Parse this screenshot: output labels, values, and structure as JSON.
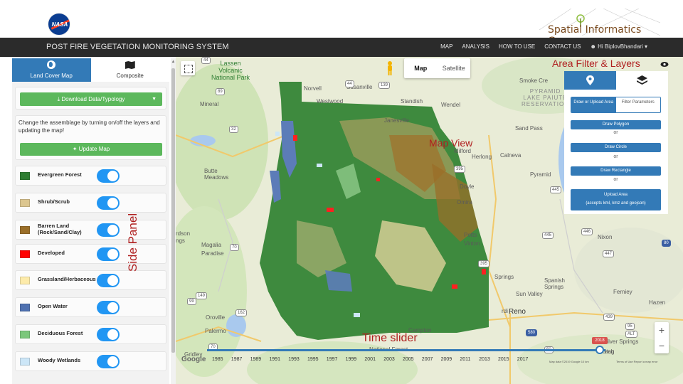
{
  "header": {
    "nasa_logo_text": "NASA",
    "sig_logo_text": "Spatial Informatics Group"
  },
  "navbar": {
    "title": "POST FIRE VEGETATION MONITORING SYSTEM",
    "links": [
      "MAP",
      "ANALYSIS",
      "HOW TO USE",
      "CONTACT US"
    ],
    "user": "Hi BiplovBhandari"
  },
  "side_panel": {
    "tabs": [
      {
        "label": "Land Cover Map",
        "icon": "globe-icon"
      },
      {
        "label": "Composite",
        "icon": "map-icon"
      }
    ],
    "download_label": "Download Data/Typology",
    "assemblage_text": "Change the assemblage by turning on/off the layers and updating the map!",
    "update_label": "Update Map",
    "legend": [
      {
        "label": "Evergreen Forest",
        "color": "#2e7d32",
        "on": true
      },
      {
        "label": "Shrub/Scrub",
        "color": "#dcc68f",
        "on": true
      },
      {
        "label": "Barren Land (Rock/Sand/Clay)",
        "color": "#9a6e28",
        "on": true
      },
      {
        "label": "Developed",
        "color": "#ff0000",
        "on": true
      },
      {
        "label": "Grassland/Herbaceous",
        "color": "#fdebaa",
        "on": true
      },
      {
        "label": "Open Water",
        "color": "#4f71b0",
        "on": true
      },
      {
        "label": "Deciduous Forest",
        "color": "#7bc77b",
        "on": true
      },
      {
        "label": "Woody Wetlands",
        "color": "#cce6f7",
        "on": true
      }
    ]
  },
  "map": {
    "type_buttons": [
      "Map",
      "Satellite"
    ],
    "places": [
      {
        "label": "Lassen Volcanic National Park",
        "lines": [
          "Lassen",
          "Volcanic",
          "National Park"
        ]
      },
      {
        "label": "Norvell"
      },
      {
        "label": "Susanville"
      },
      {
        "label": "Standish"
      },
      {
        "label": "Wendel"
      },
      {
        "label": "Mineral"
      },
      {
        "label": "Westwood"
      },
      {
        "label": "Janesville"
      },
      {
        "label": "Milford"
      },
      {
        "label": "Herlong"
      },
      {
        "label": "Calneva"
      },
      {
        "label": "Butte Meadows",
        "lines": [
          "Butte",
          "Meadows"
        ]
      },
      {
        "label": "Doyle"
      },
      {
        "label": "Omira"
      },
      {
        "label": "Magalia"
      },
      {
        "label": "Paradise"
      },
      {
        "label": "Potts"
      },
      {
        "label": "Vinton"
      },
      {
        "label": "Springs"
      },
      {
        "label": "Oroville"
      },
      {
        "label": "Palermo"
      },
      {
        "label": "Gridley"
      },
      {
        "label": "Campton"
      },
      {
        "label": "Reno"
      },
      {
        "label": "Spanish Springs",
        "lines": [
          "Spanish",
          "Springs"
        ]
      },
      {
        "label": "Sun Valley"
      },
      {
        "label": "Ferniey"
      },
      {
        "label": "Nixon"
      },
      {
        "label": "Hazen"
      },
      {
        "label": "Silver Springs"
      },
      {
        "label": "Sand Pass"
      },
      {
        "label": "Pyramid"
      },
      {
        "label": "Smoke Cre"
      },
      {
        "label": "PYRAMID LAKE PAIUTE RESERVATION",
        "lines": [
          "PYRAMID",
          "LAKE PAIUTE",
          "RESERVATION"
        ]
      },
      {
        "label": "rdson"
      },
      {
        "label": "ngs"
      },
      {
        "label": "rdi"
      },
      {
        "label": "Stag"
      },
      {
        "label": "ach"
      },
      {
        "label": "National Forest"
      }
    ],
    "highways": [
      "44",
      "89",
      "44",
      "139",
      "32",
      "395",
      "445",
      "70",
      "395",
      "445",
      "446",
      "447",
      "80",
      "149",
      "99",
      "162",
      "70",
      "580",
      "439",
      "95",
      "ALT",
      "50"
    ],
    "google_logo": "Google",
    "attribution": "Map data ©2019 Google",
    "scale": "10 km",
    "terms": "Terms of Use   Report a map error"
  },
  "annotations": {
    "area_filter": "Area Filter & Layers",
    "map_view": "Map View",
    "side_panel": "Side Panel",
    "time_slider": "Time slider"
  },
  "right_panel": {
    "toggle": [
      "Draw or Upload Area",
      "Filter Parameters"
    ],
    "buttons": [
      {
        "label": "Draw Polygon"
      },
      {
        "label": "Draw Circle"
      },
      {
        "label": "Draw Rectangle"
      },
      {
        "label": "Upload Area",
        "sub": "(accepts kml, kmz and geojson)"
      }
    ],
    "or": "or"
  },
  "time_slider": {
    "years": [
      "1985",
      "1987",
      "1989",
      "1991",
      "1993",
      "1995",
      "1997",
      "1999",
      "2001",
      "2003",
      "2005",
      "2007",
      "2009",
      "2011",
      "2013",
      "2015",
      "2017"
    ],
    "selected": "2018",
    "value": 2018,
    "min": 1985,
    "max": 2018
  },
  "colors": {
    "accent": "#337ab7",
    "green_button": "#5cb85c",
    "annotation": "#b02020",
    "navbar": "#2b2b2b"
  }
}
